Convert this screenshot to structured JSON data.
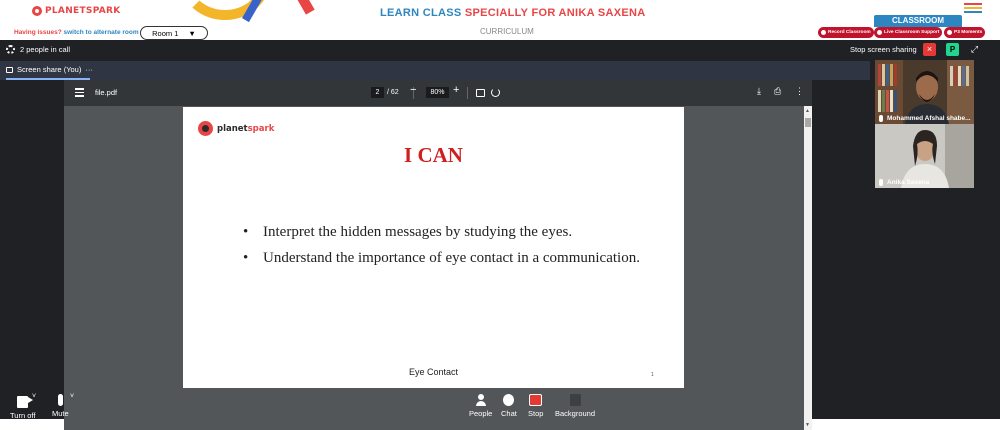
{
  "header": {
    "logo_text": "PLANETSPARK",
    "banner_part1": "LEARN CLASS ",
    "banner_part2": "SPECIALLY FOR ANIKA SAXENA",
    "classroom_button": "CLASSROOM",
    "issues_label": "Having issues?",
    "alternate_room_link": "switch to alternate room",
    "room_select_value": "Room 1",
    "curriculum_label": "CURRICULUM",
    "pills": [
      {
        "label": "Record Classroom"
      },
      {
        "label": "Live Classroom Support"
      },
      {
        "label": "P3 Moments"
      }
    ],
    "colors": {
      "brand_red": "#e84545",
      "brand_blue": "#2e86c1",
      "pill_red": "#c0142d"
    }
  },
  "meeting": {
    "people_count": "2 people in call",
    "stop_sharing_label": "Stop screen sharing",
    "close_icon": "×",
    "p_button": "P",
    "share_tab_label": "Screen share (You)",
    "share_tab_more": "···"
  },
  "pdf": {
    "filename": "file.pdf",
    "current_page": "2",
    "total_pages": "/ 62",
    "zoom": "80%",
    "page": {
      "logo_text_plain": "planet",
      "logo_text_brand": "spark",
      "title": "I CAN",
      "bullets": [
        "Interpret the hidden messages by studying the eyes.",
        "Understand the importance of eye contact in a communication."
      ],
      "footer": "Eye Contact",
      "page_number": "1"
    }
  },
  "participants": [
    {
      "name": "Mohammed Afshal shabe..."
    },
    {
      "name": "Anika Saxena"
    }
  ],
  "controls": {
    "turn_off": "Turn off",
    "mute": "Mute",
    "people": "People",
    "chat": "Chat",
    "stop": "Stop",
    "background": "Background"
  }
}
